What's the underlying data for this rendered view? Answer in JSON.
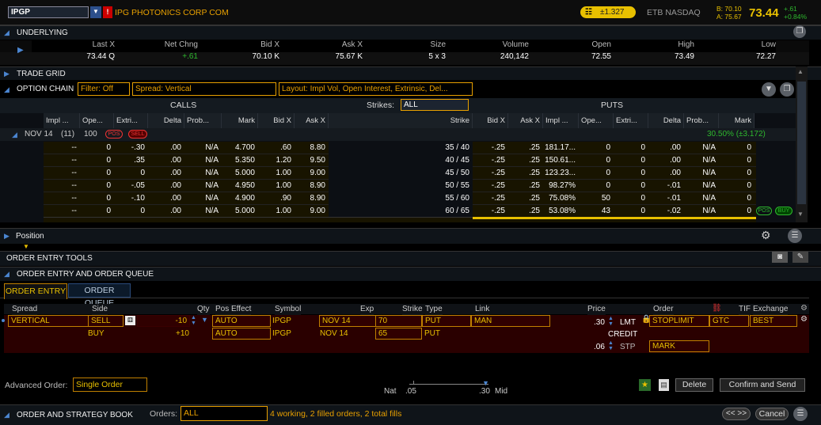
{
  "header": {
    "symbol": "IPGP",
    "company": "IPG PHOTONICS CORP COM",
    "beta": "±1.327",
    "exchange_info": "ETB  NASDAQ",
    "bid": "B: 70.10",
    "ask": "A: 75.67",
    "last": "73.44",
    "change": "+.61",
    "change_pct": "+0.84%"
  },
  "underlying": {
    "title": "UNDERLYING",
    "headers": [
      "Last X",
      "Net Chng",
      "Bid X",
      "Ask X",
      "Size",
      "Volume",
      "Open",
      "High",
      "Low"
    ],
    "values": [
      "73.44 Q",
      "+.61",
      "70.10 K",
      "75.67 K",
      "5 x 3",
      "240,142",
      "72.55",
      "73.49",
      "72.27"
    ]
  },
  "trade_grid": {
    "title": "TRADE GRID"
  },
  "option_chain": {
    "title": "OPTION CHAIN",
    "filter": "Filter: Off",
    "spread": "Spread: Vertical",
    "layout": "Layout: Impl Vol, Open Interest, Extrinsic, Del...",
    "calls_label": "CALLS",
    "puts_label": "PUTS",
    "strikes_label": "Strikes:",
    "strikes_value": "ALL",
    "call_headers": [
      "Impl ...",
      "Ope...",
      "Extri...",
      "Delta",
      "Prob...",
      "Mark",
      "Bid X",
      "Ask X"
    ],
    "strike_header": "Strike",
    "put_headers": [
      "Bid X",
      "Ask X",
      "Impl ...",
      "Ope...",
      "Extri...",
      "Delta",
      "Prob...",
      "Mark"
    ],
    "expiry": "NOV 14",
    "expiry_days": "(11)",
    "expiry_mult": "100",
    "pos_label": "POS",
    "sell_label": "SELL",
    "buy_label": "BUY",
    "expiry_iv": "30.50% (±3.172)",
    "rows": [
      {
        "c": [
          "--",
          "0",
          "-.30",
          ".00",
          "N/A",
          "4.700",
          ".60",
          "8.80"
        ],
        "strike": "35 / 40",
        "p": [
          "-.25",
          ".25",
          "181.17...",
          "0",
          "0",
          ".00",
          "N/A",
          "0"
        ]
      },
      {
        "c": [
          "--",
          "0",
          ".35",
          ".00",
          "N/A",
          "5.350",
          "1.20",
          "9.50"
        ],
        "strike": "40 / 45",
        "p": [
          "-.25",
          ".25",
          "150.61...",
          "0",
          "0",
          ".00",
          "N/A",
          "0"
        ]
      },
      {
        "c": [
          "--",
          "0",
          "0",
          ".00",
          "N/A",
          "5.000",
          "1.00",
          "9.00"
        ],
        "strike": "45 / 50",
        "p": [
          "-.25",
          ".25",
          "123.23...",
          "0",
          "0",
          ".00",
          "N/A",
          "0"
        ]
      },
      {
        "c": [
          "--",
          "0",
          "-.05",
          ".00",
          "N/A",
          "4.950",
          "1.00",
          "8.90"
        ],
        "strike": "50 / 55",
        "p": [
          "-.25",
          ".25",
          "98.27%",
          "0",
          "0",
          "-.01",
          "N/A",
          "0"
        ]
      },
      {
        "c": [
          "--",
          "0",
          "-.10",
          ".00",
          "N/A",
          "4.900",
          ".90",
          "8.90"
        ],
        "strike": "55 / 60",
        "p": [
          "-.25",
          ".25",
          "75.08%",
          "50",
          "0",
          "-.01",
          "N/A",
          "0"
        ]
      },
      {
        "c": [
          "--",
          "0",
          "0",
          ".00",
          "N/A",
          "5.000",
          "1.00",
          "9.00"
        ],
        "strike": "60 / 65",
        "p": [
          "-.25",
          ".25",
          "53.08%",
          "43",
          "0",
          "-.02",
          "N/A",
          "0"
        ]
      }
    ]
  },
  "position": {
    "title": "Position"
  },
  "order_entry_tools": {
    "title": "ORDER ENTRY TOOLS"
  },
  "order_queue_section": {
    "title": "ORDER ENTRY AND ORDER QUEUE"
  },
  "tabs": {
    "order_entry": "ORDER ENTRY",
    "order_queue": "ORDER QUEUE"
  },
  "order": {
    "headers": [
      "Spread",
      "Side",
      "Qty",
      "Pos Effect",
      "Symbol",
      "Exp",
      "Strike",
      "Type",
      "Link",
      "Price",
      "Order",
      "TIF",
      "Exchange"
    ],
    "spread": "VERTICAL",
    "leg1": {
      "side": "SELL",
      "qty": "-10",
      "pos_effect": "AUTO",
      "symbol": "IPGP",
      "exp": "NOV 14",
      "strike": "70",
      "type": "PUT",
      "link": "MAN"
    },
    "leg2": {
      "side": "BUY",
      "qty": "+10",
      "pos_effect": "AUTO",
      "symbol": "IPGP",
      "exp": "NOV 14",
      "strike": "65",
      "type": "PUT"
    },
    "price": ".30",
    "price_type": "LMT",
    "credit": "CREDIT",
    "stop_price": ".06",
    "stop_type": "STP",
    "order_type": "STOPLIMIT",
    "order_type2": "MARK",
    "tif": "GTC",
    "exchange": "BEST",
    "advanced_label": "Advanced Order:",
    "advanced_value": "Single Order",
    "nat_label": "Nat",
    "nat_value": ".05",
    "mid_value": ".30",
    "mid_label": "Mid",
    "delete": "Delete",
    "confirm": "Confirm and Send"
  },
  "book": {
    "title": "ORDER AND STRATEGY BOOK",
    "orders_label": "Orders:",
    "orders_value": "ALL",
    "summary": "4 working, 2 filled orders, 2 total fills",
    "nav": "<< >>",
    "cancel": "Cancel"
  }
}
